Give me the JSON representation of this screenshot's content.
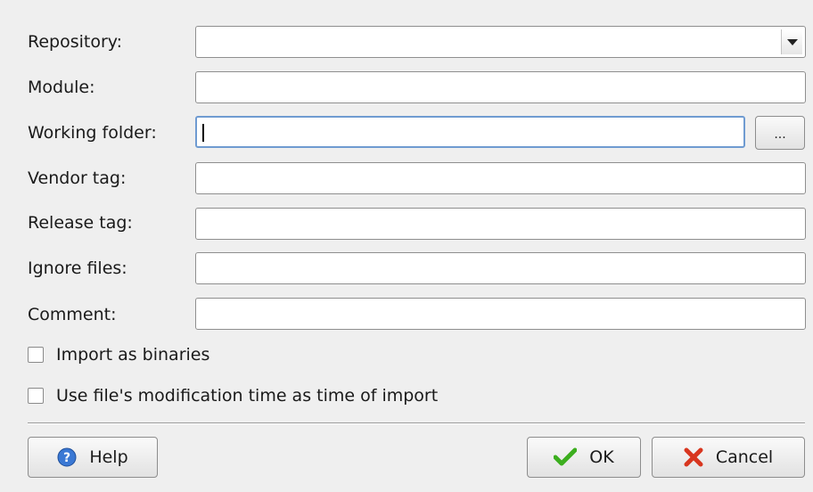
{
  "dialog": {
    "fields": [
      {
        "label": "Repository:",
        "value": ""
      },
      {
        "label": "Module:",
        "value": ""
      },
      {
        "label": "Working folder:",
        "value": ""
      },
      {
        "label": "Vendor tag:",
        "value": ""
      },
      {
        "label": "Release tag:",
        "value": ""
      },
      {
        "label": "Ignore files:",
        "value": ""
      },
      {
        "label": "Comment:",
        "value": ""
      }
    ],
    "browse_label": "...",
    "checkboxes": [
      {
        "label": "Import as binaries",
        "checked": false
      },
      {
        "label": "Use file's modification time as time of import",
        "checked": false
      }
    ]
  },
  "buttons": {
    "help": "Help",
    "ok": "OK",
    "cancel": "Cancel"
  },
  "colors": {
    "background": "#efefef",
    "focus_border": "#6f9bd1",
    "help_icon": "#3a78d4",
    "ok_icon": "#3cae1e",
    "cancel_icon": "#d8361f"
  }
}
